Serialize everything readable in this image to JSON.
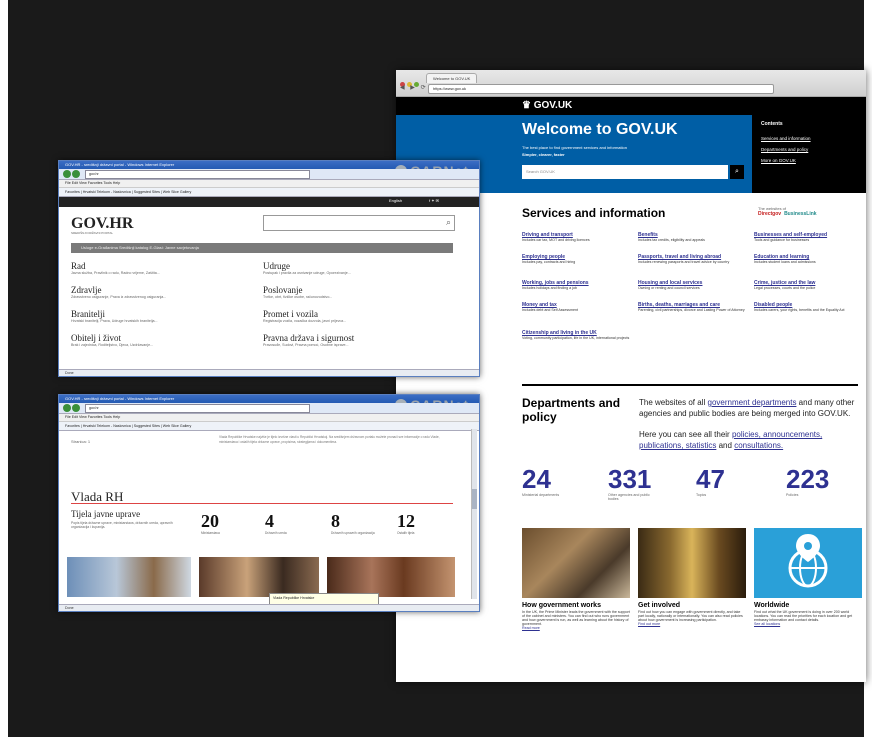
{
  "govuk": {
    "tab_title": "Welcome to GOV.UK",
    "url": "https://www.gov.uk",
    "logo": "GOV.UK",
    "hero_title": "Welcome to GOV.UK",
    "intro": "The best place to find government services and information",
    "intro2": "Simpler, clearer, faster",
    "search_placeholder": "Search GOV.UK",
    "contents_title": "Contents",
    "contents": [
      "Services and information",
      "Departments and policy",
      "More on GOV.UK"
    ],
    "services_title": "Services and information",
    "directgov_note": "The websites of",
    "directgov": "Directgov",
    "businesslink": "BusinessLink",
    "services": [
      {
        "title": "Driving and transport",
        "desc": "Includes car tax, MOT and driving licences"
      },
      {
        "title": "Benefits",
        "desc": "Includes tax credits, eligibility and appeals"
      },
      {
        "title": "Businesses and self-employed",
        "desc": "Tools and guidance for businesses"
      },
      {
        "title": "Employing people",
        "desc": "Includes pay, contracts and hiring"
      },
      {
        "title": "Passports, travel and living abroad",
        "desc": "Includes renewing passports and travel advice by country"
      },
      {
        "title": "Education and learning",
        "desc": "Includes student loans and admissions"
      },
      {
        "title": "Working, jobs and pensions",
        "desc": "Includes holidays and finding a job"
      },
      {
        "title": "Housing and local services",
        "desc": "Owning or renting and council services"
      },
      {
        "title": "Crime, justice and the law",
        "desc": "Legal processes, courts and the police"
      },
      {
        "title": "Money and tax",
        "desc": "Includes debt and Self Assessment"
      },
      {
        "title": "Births, deaths, marriages and care",
        "desc": "Parenting, civil partnerships, divorce and Lasting Power of Attorney"
      },
      {
        "title": "Disabled people",
        "desc": "Includes carers, your rights, benefits and the Equality Act"
      },
      {
        "title": "Citizenship and living in the UK",
        "desc": "Voting, community participation, life in the UK, international projects"
      }
    ],
    "dept_title": "Departments and policy",
    "dept_text_pre": "The websites of all",
    "dept_text_link": "government departments",
    "dept_text_post": "and many other agencies and public bodies are being merged into GOV.UK.",
    "dept_text2_pre": "Here you can see all their",
    "dept_text2_links": "policies, announcements, publications, statistics",
    "dept_text2_and": "and",
    "dept_text2_last": "consultations.",
    "stats": [
      {
        "number": "24",
        "label": "Ministerial departments"
      },
      {
        "number": "331",
        "label": "Other agencies and public bodies"
      },
      {
        "number": "47",
        "label": "Topics"
      },
      {
        "number": "223",
        "label": "Policies"
      }
    ],
    "cards": [
      {
        "title": "How government works",
        "desc": "In the UK, the Prime Minister leads the government with the support of the cabinet and ministers. You can find out who runs government and how government is run, as well as learning about the history of government.",
        "more": "Read more"
      },
      {
        "title": "Get involved",
        "desc": "Find out how you can engage with government directly, and take part locally, nationally or internationally. You can also read policies about how government is increasing participation.",
        "more": "Find out more"
      },
      {
        "title": "Worldwide",
        "desc": "Find out what the UK government is doing in over 200 world locations. You can read the priorities for each location and get embassy information and contact details.",
        "more": "See all locations"
      }
    ]
  },
  "carnet": "CARNet",
  "hr1": {
    "title": "GOV.HR - središnji državni portal - Windows Internet Explorer",
    "url": "gov.hr",
    "menu": "File   Edit   View   Favorites   Tools   Help",
    "favs": "Favorites   |   Hrvatski Telekom - Naslovnica   |   Suggested Sites   |   Web Slice Gallery",
    "top_links": "English",
    "logo": "GOV.HR",
    "logo_sub": "SREDIŠNJI DRŽAVNI PORTAL",
    "nav": "Usluge e-Građanima   Središnji katalog   E-Glasi: Javne savjetovanja",
    "items": [
      {
        "title": "Rad",
        "desc": "Javna služba, Pravilnik o radu, Radno vrijeme, Zaštita..."
      },
      {
        "title": "Udruge",
        "desc": "Postupak i pravila za osnivanje udruge, Oporezivanje..."
      },
      {
        "title": "Zdravlje",
        "desc": "Zdravstveno osiguranje, Prava iz zdravstvenog osiguranja..."
      },
      {
        "title": "Poslovanje",
        "desc": "Tvrtke, obrt, fizičke osobe, računovodstvo..."
      },
      {
        "title": "Branitelji",
        "desc": "Hrvatski branitelji, Prava, Udruge hrvatskih branitelja..."
      },
      {
        "title": "Promet i vozila",
        "desc": "Registracija vozila, vozačka dozvola, javni prijevoz..."
      },
      {
        "title": "Obitelj i život",
        "desc": "Brak i zajednica, Roditeljstvo, Djeca, Uzdržavanje..."
      },
      {
        "title": "Pravna država i sigurnost",
        "desc": "Pravosuđe, Sudovi, Pravna pomoć, Osobne isprave..."
      }
    ],
    "status": "Done"
  },
  "hr2": {
    "title": "GOV.HR - središnji državni portal - Windows Internet Explorer",
    "url": "gov.hr",
    "menu": "File   Edit   View   Favorites   Tools   Help",
    "favs": "Favorites   |   Hrvatski Telekom - Naslovnica   |   Suggested Sites   |   Web Slice Gallery",
    "pages": "Stranica: 1",
    "body_text": "Vlada Republike Hrvatske najviše je tijelo izvršne vlasti u Republici Hrvatskoj. Na središnjem državnom portalu možete pronaći sve informacije o radu Vlade, ministarstava i ostalih tijela državne uprave, propisima, strategijama i dokumentima.",
    "heading": "Vlada RH",
    "subheading": "Tijela javne uprave",
    "sub_desc": "Popis tijela državne uprave, ministarstava, državnih ureda, upravnih organizacija i županija.",
    "stats": [
      {
        "number": "20",
        "label": "Ministarstava"
      },
      {
        "number": "4",
        "label": "Državnih ureda"
      },
      {
        "number": "8",
        "label": "Državnih upravnih organizacija"
      },
      {
        "number": "12",
        "label": "Ostalih tijela"
      }
    ],
    "popup": "Vlada Republike Hrvatske",
    "status": "Done"
  },
  "colors": {
    "govuk_blue": "#005ea5",
    "govuk_link": "#2e3191",
    "ie_blue": "#245ab3"
  }
}
